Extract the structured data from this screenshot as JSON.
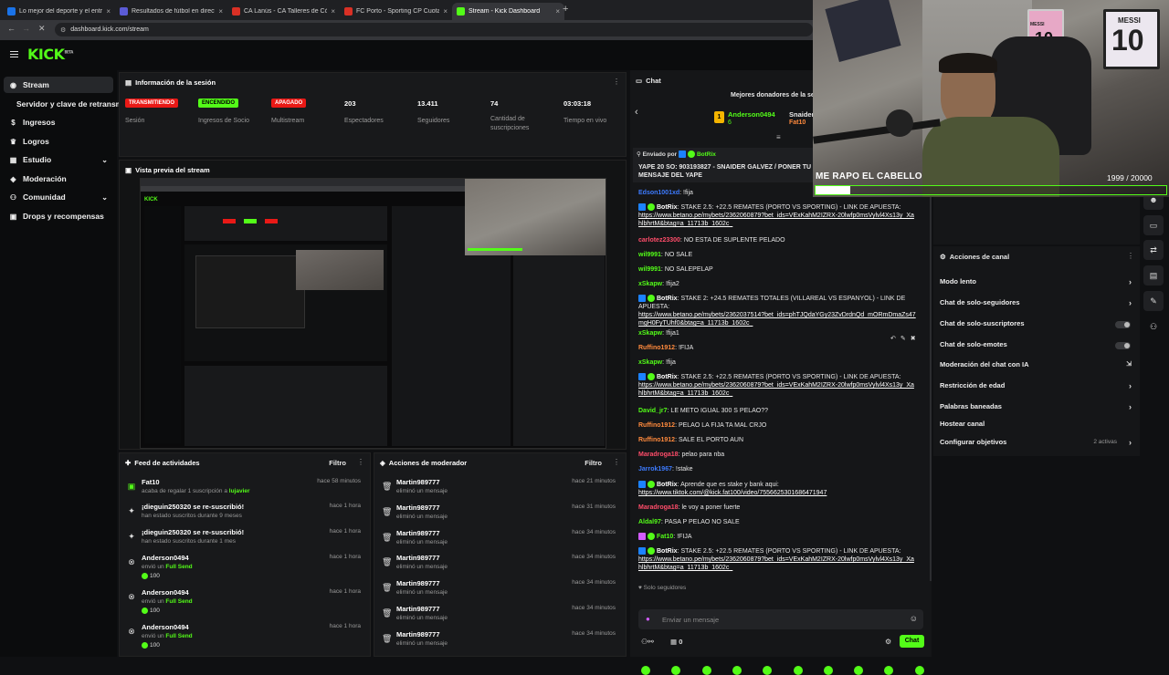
{
  "browser": {
    "tabs": [
      {
        "title": "Lo mejor del deporte y el entre",
        "color": "#1a73e8"
      },
      {
        "title": "Resultados de fútbol en direct",
        "color": "#5b5bd6"
      },
      {
        "title": "CA Lanús - CA Talleres de Córd",
        "color": "#d93025"
      },
      {
        "title": "FC Porto - Sporting CP Cuotas",
        "color": "#d93025"
      },
      {
        "title": "Stream - Kick Dashboard",
        "color": "#53fc18"
      }
    ],
    "new_tab": "+",
    "url": "dashboard.kick.com/stream"
  },
  "brand": {
    "logo": "KICK",
    "logo_sup": "BETA"
  },
  "sidebar": {
    "items": [
      {
        "label": "Stream",
        "icon": "broadcast-icon"
      },
      {
        "label": "Servidor y clave de retransmisión"
      },
      {
        "label": "Ingresos",
        "icon": "money-icon"
      },
      {
        "label": "Logros",
        "icon": "trophy-icon"
      },
      {
        "label": "Estudio",
        "icon": "studio-icon"
      },
      {
        "label": "Moderación",
        "icon": "shield-icon"
      },
      {
        "label": "Comunidad",
        "icon": "community-icon"
      },
      {
        "label": "Drops y recompensas",
        "icon": "gift-icon"
      }
    ]
  },
  "session": {
    "title": "Información de la sesión",
    "stats": [
      {
        "badge": "TRANSMITIENDO",
        "badge_color": "#e91916",
        "label": "Sesión"
      },
      {
        "badge": "ENCENDIDO",
        "badge_color": "#53fc18",
        "label": "Ingresos de Socio"
      },
      {
        "badge": "APAGADO",
        "badge_color": "#e91916",
        "label": "Multistream"
      },
      {
        "value": "203",
        "label": "Espectadores"
      },
      {
        "value": "13.411",
        "label": "Seguidores"
      },
      {
        "value": "74",
        "label": "Cantidad de suscripciones"
      },
      {
        "value": "03:03:18",
        "label": "Tiempo en vivo"
      }
    ]
  },
  "preview": {
    "title": "Vista previa del stream"
  },
  "feed": {
    "title": "Feed de actividades",
    "filter": "Filtro",
    "items": [
      {
        "name": "Fat10",
        "text": "acaba de regalar 1 suscripción a",
        "target": "lujavier",
        "time": "hace 58 minutos"
      },
      {
        "name": "¡dieguin250320 se re-suscribió!",
        "text": "han estado suscritos durante 9 meses",
        "time": "hace 1 hora"
      },
      {
        "name": "¡dieguin250320 se re-suscribió!",
        "text": "han estado suscritos durante 1 mes",
        "time": "hace 1 hora"
      },
      {
        "name": "Anderson0494",
        "text": "envió un",
        "target": "Full Send",
        "amount": "100",
        "time": "hace 1 hora"
      },
      {
        "name": "Anderson0494",
        "text": "envió un",
        "target": "Full Send",
        "amount": "100",
        "time": "hace 1 hora"
      },
      {
        "name": "Anderson0494",
        "text": "envió un",
        "target": "Full Send",
        "amount": "100",
        "time": "hace 1 hora"
      }
    ]
  },
  "mod": {
    "title": "Acciones de moderador",
    "filter": "Filtro",
    "items": [
      {
        "name": "Martin989777",
        "text": "eliminó un mensaje",
        "time": "hace 21 minutos"
      },
      {
        "name": "Martin989777",
        "text": "eliminó un mensaje",
        "time": "hace 31 minutos"
      },
      {
        "name": "Martin989777",
        "text": "eliminó un mensaje",
        "time": "hace 34 minutos"
      },
      {
        "name": "Martin989777",
        "text": "eliminó un mensaje",
        "time": "hace 34 minutos"
      },
      {
        "name": "Martin989777",
        "text": "eliminó un mensaje",
        "time": "hace 34 minutos"
      },
      {
        "name": "Martin989777",
        "text": "eliminó un mensaje",
        "time": "hace 34 minutos"
      },
      {
        "name": "Martin989777",
        "text": "eliminó un mensaje",
        "time": "hace 34 minutos"
      }
    ]
  },
  "chat": {
    "title": "Chat",
    "donors_title": "Mejores donadores de la se",
    "donors": [
      {
        "rank": "1",
        "name": "Anderson0494",
        "amount": "6"
      },
      {
        "name": "Snaider"
      },
      {
        "name": "Fat10"
      }
    ],
    "pinned": {
      "label": "Enviado por",
      "sender": "BotRix",
      "text": "YAPE 20 SO: 903193827 - SNAIDER GALVEZ / PONER TU MENSAJE DEL YAPE"
    },
    "messages": [
      {
        "user": "Edson1001xd",
        "color": "#3d7bff",
        "text": "!fija"
      },
      {
        "user": "BotRix",
        "color": "#ffffff",
        "bot": true,
        "text": "STAKE 2.5: +22.5 REMATES (PORTO VS SPORTING) - LINK DE APUESTA:",
        "link": "https://www.betano.pe/mybets/2362060879?bet_ids=VExKahM2IZRX-20lwfp0msVylvl4Xs13y_XahlbhrtM&btag=a_11713b_1602c_"
      },
      {
        "user": "carlotez23300",
        "color": "#ff4d6a",
        "text": "NO ESTA DE SUPLENTE PELADO"
      },
      {
        "user": "wil9991",
        "color": "#53fc18",
        "text": "NO SALE"
      },
      {
        "user": "wil9991",
        "color": "#53fc18",
        "text": "NO SALEPELAP"
      },
      {
        "user": "xSkapw",
        "color": "#53fc18",
        "text": "!fija2"
      },
      {
        "user": "BotRix",
        "color": "#ffffff",
        "bot": true,
        "text": "STAKE 2: +24.5 REMATES TOTALES (VILLAREAL VS ESPANYOL) - LINK DE APUESTA:",
        "link": "https://www.betano.pe/mybets/2362037514?bet_ids=phTJQdaYGy23ZvDrdnQd_mORmDmaZs47mgH0FyTUhf0&btag=a_11713b_1602c_"
      },
      {
        "user": "xSkapw",
        "color": "#53fc18",
        "text": "!fija1"
      },
      {
        "user": "Ruffino1912",
        "color": "#ff8a3d",
        "text": "!FIJA"
      },
      {
        "user": "xSkapw",
        "color": "#53fc18",
        "text": "!fija"
      },
      {
        "user": "BotRix",
        "color": "#ffffff",
        "bot": true,
        "text": "STAKE 2.5: +22.5 REMATES (PORTO VS SPORTING) - LINK DE APUESTA:",
        "link": "https://www.betano.pe/mybets/2362060879?bet_ids=VExKahM2IZRX-20lwfp0msVylvl4Xs13y_XahlbhrtM&btag=a_11713b_1602c_"
      },
      {
        "user": "David_jr7",
        "color": "#53fc18",
        "text": "LE METO IGUAL 300 S PELAO??"
      },
      {
        "user": "Ruffino1912",
        "color": "#ff8a3d",
        "text": "PELAO LA FIJA TA MAL CRJO"
      },
      {
        "user": "Ruffino1912",
        "color": "#ff8a3d",
        "text": "SALE EL PORTO AUN"
      },
      {
        "user": "Maradroga18",
        "color": "#ff4d6a",
        "text": "pelao para nba"
      },
      {
        "user": "Jarrok1967",
        "color": "#3d7bff",
        "text": "!stake"
      },
      {
        "user": "BotRix",
        "color": "#ffffff",
        "bot": true,
        "text": "Aprende que es stake y bank aqui:",
        "link": "https://www.tiktok.com/@kick.fat100/video/7556625301686471947"
      },
      {
        "user": "Maradroga18",
        "color": "#ff4d6a",
        "text": "le voy a poner fuerte"
      },
      {
        "user": "Aldal97",
        "color": "#53fc18",
        "text": "PASA P PELAO NO SALE"
      },
      {
        "user": "Fat10",
        "color": "#53fc18",
        "text": "!FIJA"
      },
      {
        "user": "BotRix",
        "color": "#ffffff",
        "bot": true,
        "text": "STAKE 2.5: +22.5 REMATES (PORTO VS SPORTING) - LINK DE APUESTA:",
        "link": "https://www.betano.pe/mybets/2362060879?bet_ids=VExKahM2IZRX-20lwfp0msVylvl4Xs13y_XahlbhrtM&btag=a_11713b_1602c_"
      }
    ],
    "followers_only": "Solo seguidores",
    "input_placeholder": "Enviar un mensaje",
    "count": "0",
    "send": "Chat"
  },
  "actions": {
    "title": "Acciones de canal",
    "items": [
      {
        "label": "Modo lento",
        "control": "arrow"
      },
      {
        "label": "Chat de solo-seguidores",
        "control": "arrow"
      },
      {
        "label": "Chat de solo-suscriptores",
        "control": "toggle"
      },
      {
        "label": "Chat de solo-emotes",
        "control": "toggle"
      },
      {
        "label": "Moderación del chat con IA",
        "control": "external"
      },
      {
        "label": "Restricción de edad",
        "control": "arrow"
      },
      {
        "label": "Palabras baneadas",
        "control": "arrow"
      },
      {
        "label": "Hostear canal",
        "control": "none"
      },
      {
        "label": "Configurar objetivos",
        "control": "arrow",
        "badge": "2 activas"
      }
    ]
  },
  "overlay": {
    "goal_text": "ME RAPO EL CABELLO",
    "goal_current": "1999",
    "goal_target": "/ 20000",
    "goal_progress": 0.1,
    "jersey_name": "MESSI",
    "jersey_number": "10"
  }
}
